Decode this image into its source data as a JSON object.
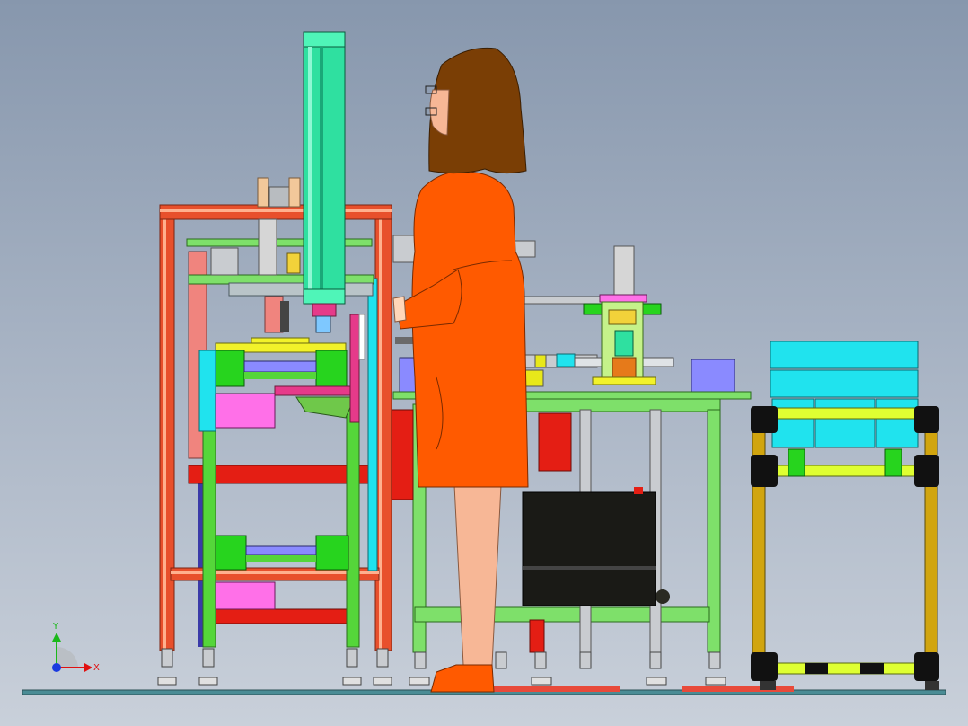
{
  "viewport": {
    "triad": {
      "x_label": "X",
      "y_label": "Y"
    }
  },
  "colors": {
    "background_top": "#8797ad",
    "frame_orange": "#e8502c",
    "rail_green": "#55d63a",
    "cylinder_teal": "#2fe0a0",
    "cabinet_cyan": "#20e3ee",
    "robot_coat": "#ff5a00",
    "robot_hair": "#7a3e05",
    "skin": "#f7b796",
    "cart_yellow": "#d1a50f",
    "cart_lime": "#dfff32",
    "magenta": "#ff70e8",
    "red": "#e41e14",
    "power_box": "#1a1a16"
  }
}
